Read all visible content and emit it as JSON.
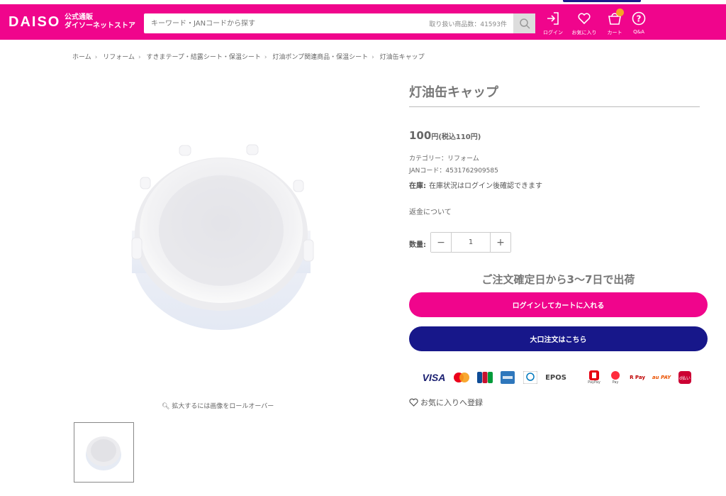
{
  "header": {
    "logo": "DAISO",
    "logo_sub1": "公式通販",
    "logo_sub2": "ダイソーネットストア",
    "search_placeholder": "キーワード・JANコードから探す",
    "search_count": "取り扱い商品数：41593件",
    "icons": [
      {
        "name": "login-icon",
        "label": "ログイン"
      },
      {
        "name": "heart-icon",
        "label": "お気に入り"
      },
      {
        "name": "cart-icon",
        "label": "カート"
      },
      {
        "name": "help-icon",
        "label": "Q&A"
      }
    ]
  },
  "breadcrumb": [
    "ホーム",
    "リフォーム",
    "すきまテープ・結露シート・保温シート",
    "灯油ポンプ関連商品・保温シート",
    "灯油缶キャップ"
  ],
  "gallery": {
    "zoom_hint": "拡大するには画像をロールオーバー"
  },
  "product": {
    "title": "灯油缶キャップ",
    "price": "100",
    "price_unit": "円",
    "price_tax": "(税込110円)",
    "category": "カテゴリー：リフォーム",
    "jan": "JANコード：4531762909585",
    "stock_label": "在庫:",
    "stock_value": "在庫状況はログイン後確認できます",
    "refund_link": "返金について",
    "qty_label": "数量:",
    "qty_value": "1",
    "qty_minus": "−",
    "qty_plus": "+",
    "shipping": "ご注文確定日から3〜7日で出荷",
    "cart_button": "ログインしてカートに入れる",
    "bulk_button": "大口注文はこちら",
    "favorite": "お気に入りへ登録"
  },
  "payments": {
    "visa": "VISA",
    "epos": "EPOS",
    "paypay": "PayPay",
    "merpay": "Pay",
    "rpay": "R Pay",
    "aupay": "au PAY",
    "dbarai": "d払い"
  },
  "colors": {
    "brand_pink": "#f0058c",
    "navy": "#17178a"
  }
}
